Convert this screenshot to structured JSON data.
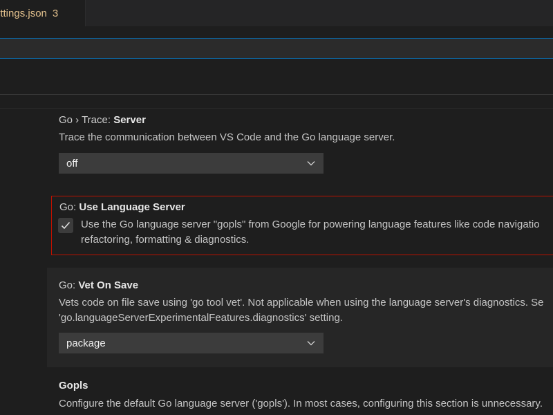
{
  "tab": {
    "name": "ettings.json",
    "problems_count": "3"
  },
  "search": {
    "value": "",
    "placeholder": ""
  },
  "settings": {
    "trace_server": {
      "category": "Go › Trace: ",
      "name": "Server",
      "description": "Trace the communication between VS Code and the Go language server.",
      "value": "off"
    },
    "use_language_server": {
      "category": "Go: ",
      "name": "Use Language Server",
      "description_line1": "Use the Go language server \"gopls\" from Google for powering language features like code navigatio",
      "description_line2": "refactoring, formatting & diagnostics.",
      "checked": true
    },
    "vet_on_save": {
      "category": "Go: ",
      "name": "Vet On Save",
      "description_line1": "Vets code on file save using 'go tool vet'. Not applicable when using the language server's diagnostics. Se",
      "description_line2": "'go.languageServerExperimentalFeatures.diagnostics' setting.",
      "value": "package"
    },
    "gopls": {
      "name": "Gopls",
      "description": "Configure the default Go language server ('gopls'). In most cases, configuring this section is unnecessary."
    }
  },
  "colors": {
    "highlight_border": "#be1100",
    "modified_tab_text": "#e2c08d",
    "focus_border": "#0e639c"
  }
}
